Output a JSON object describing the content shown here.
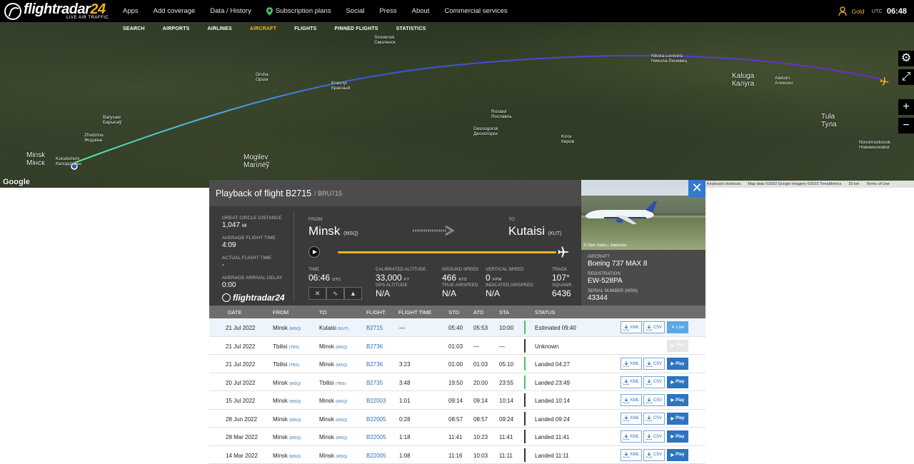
{
  "header": {
    "brand_word": "flightradar",
    "brand_num": "24",
    "brand_sub": "LIVE AIR TRAFFIC",
    "nav": [
      "Apps",
      "Add coverage",
      "Data / History",
      "Subscription plans",
      "Social",
      "Press",
      "About",
      "Commercial services"
    ],
    "user_tier": "Gold",
    "utc_label": "UTC",
    "time": "06:48"
  },
  "subnav": [
    "SEARCH",
    "AIRPORTS",
    "AIRLINES",
    "AIRCRAFT",
    "FLIGHTS",
    "PINNED FLIGHTS",
    "STATISTICS"
  ],
  "map": {
    "cities": [
      {
        "name": "Minsk\nМінск"
      },
      {
        "name": "Kolodishchi\nКалодзішчы"
      },
      {
        "name": "Zhodzina\nЖодзіна"
      },
      {
        "name": "Barysaw\nБарысаў"
      },
      {
        "name": "Mogilev\nМагілёў"
      },
      {
        "name": "Krasnyi\nКрасный"
      },
      {
        "name": "Smolensk\nСмоленск"
      },
      {
        "name": "Roslavl\nРославль"
      },
      {
        "name": "Kaluga\nКалуга"
      },
      {
        "name": "Tula\nТула"
      },
      {
        "name": "Novomoskovsk\nНовомосковск"
      },
      {
        "name": "Kirov\nКиров"
      },
      {
        "name": "Desnogorsk\nДесногорск"
      },
      {
        "name": "Nikola-Lenivets\nНикола-Ленивец"
      },
      {
        "name": "Aleksin\nАлексин"
      },
      {
        "name": "Orsha\nОрша"
      }
    ],
    "google": "Google",
    "footer": [
      "Keyboard shortcuts",
      "Map data ©2022 Google Imagery ©2022 TerraMetrics",
      "20 km",
      "Terms of Use"
    ]
  },
  "panel": {
    "title": "Playback of flight B2715",
    "subtitle": "/ BRU715",
    "stats": [
      {
        "label": "GREAT CIRCLE DISTANCE",
        "value": "1,047",
        "unit": "MI"
      },
      {
        "label": "AVERAGE FLIGHT TIME",
        "value": "4:09",
        "unit": ""
      },
      {
        "label": "ACTUAL FLIGHT TIME",
        "value": "-",
        "unit": ""
      },
      {
        "label": "AVERAGE ARRIVAL DELAY",
        "value": "0:00",
        "unit": ""
      }
    ],
    "logo": "flightradar24",
    "from_label": "FROM",
    "from_city": "Minsk",
    "from_code": "(MSQ)",
    "to_label": "TO",
    "to_city": "Kutaisi",
    "to_code": "(KUT)",
    "progress": 1.0,
    "time_label": "TIME",
    "time_value": "06:46",
    "time_unit": "UTC",
    "cal_alt_label": "CALIBRATED ALTITUDE",
    "cal_alt_value": "33,000",
    "cal_alt_unit": "FT",
    "gps_alt_label": "GPS ALTITUDE",
    "gps_alt_value": "N/A",
    "gs_label": "GROUND SPEED",
    "gs_value": "466",
    "gs_unit": "KTS",
    "tas_label": "TRUE AIRSPEED",
    "tas_value": "N/A",
    "vs_label": "VERTICAL SPEED",
    "vs_value": "0",
    "vs_unit": "FPM",
    "ias_label": "INDICATED AIRSPEED",
    "ias_value": "N/A",
    "track_label": "TRACK",
    "track_value": "107°",
    "squawk_label": "SQUAWK",
    "squawk_value": "6436"
  },
  "aircraft": {
    "photo_credit": "© Gleb Salko | Jetphotos",
    "aircraft_label": "AIRCRAFT",
    "aircraft_value": "Boeing 737 MAX 8",
    "reg_label": "REGISTRATION",
    "reg_value": "EW-528PA",
    "msn_label": "SERIAL NUMBER (MSN)",
    "msn_value": "43344"
  },
  "table": {
    "headers": [
      "DATE",
      "FROM",
      "TO",
      "FLIGHT",
      "FLIGHT TIME",
      "STD",
      "ATD",
      "STA",
      "STATUS"
    ],
    "kml": "KML",
    "csv": "CSV",
    "rows": [
      {
        "date": "21 Jul 2022",
        "from": "Minsk",
        "from_code": "(MSQ)",
        "to": "Kutaisi",
        "to_code": "(KUT)",
        "flight": "B2715",
        "ftime": "—",
        "std": "05:40",
        "atd": "05:53",
        "sta": "10:00",
        "status": "Estimated 09:40",
        "action": "Live",
        "bar": "green",
        "current": true,
        "downloads": true
      },
      {
        "date": "21 Jul 2022",
        "from": "Tbilisi",
        "from_code": "(TBS)",
        "to": "Minsk",
        "to_code": "(MSQ)",
        "flight": "B2736",
        "ftime": "",
        "std": "01:03",
        "atd": "—",
        "sta": "—",
        "status": "Unknown",
        "action": "Play",
        "bar": "dark",
        "current": false,
        "downloads": false
      },
      {
        "date": "21 Jul 2022",
        "from": "Tbilisi",
        "from_code": "(TBS)",
        "to": "Minsk",
        "to_code": "(MSQ)",
        "flight": "B2736",
        "ftime": "3:23",
        "std": "01:00",
        "atd": "01:03",
        "sta": "05:10",
        "status": "Landed 04:27",
        "action": "Play",
        "bar": "green",
        "current": false,
        "downloads": true
      },
      {
        "date": "20 Jul 2022",
        "from": "Minsk",
        "from_code": "(MSQ)",
        "to": "Tbilisi",
        "to_code": "(TBS)",
        "flight": "B2735",
        "ftime": "3:48",
        "std": "19:50",
        "atd": "20:00",
        "sta": "23:55",
        "status": "Landed 23:49",
        "action": "Play",
        "bar": "green",
        "current": false,
        "downloads": true
      },
      {
        "date": "15 Jul 2022",
        "from": "Minsk",
        "from_code": "(MSQ)",
        "to": "Minsk",
        "to_code": "(MSQ)",
        "flight": "B22003",
        "ftime": "1:01",
        "std": "09:14",
        "atd": "09:14",
        "sta": "10:14",
        "status": "Landed 10:14",
        "action": "Play",
        "bar": "dark",
        "current": false,
        "downloads": true
      },
      {
        "date": "28 Jun 2022",
        "from": "Minsk",
        "from_code": "(MSQ)",
        "to": "Minsk",
        "to_code": "(MSQ)",
        "flight": "B22005",
        "ftime": "0:28",
        "std": "08:57",
        "atd": "08:57",
        "sta": "09:24",
        "status": "Landed 09:24",
        "action": "Play",
        "bar": "dark",
        "current": false,
        "downloads": true
      },
      {
        "date": "28 Mar 2022",
        "from": "Minsk",
        "from_code": "(MSQ)",
        "to": "Minsk",
        "to_code": "(MSQ)",
        "flight": "B22005",
        "ftime": "1:18",
        "std": "11:41",
        "atd": "10:23",
        "sta": "11:41",
        "status": "Landed 11:41",
        "action": "Play",
        "bar": "dark",
        "current": false,
        "downloads": true
      },
      {
        "date": "14 Mar 2022",
        "from": "Minsk",
        "from_code": "(MSQ)",
        "to": "Minsk",
        "to_code": "(MSQ)",
        "flight": "B22005",
        "ftime": "1:08",
        "std": "11:16",
        "atd": "10:03",
        "sta": "11:11",
        "status": "Landed 11:11",
        "action": "Play",
        "bar": "dark",
        "current": false,
        "downloads": true
      }
    ]
  },
  "colors": {
    "accent": "#f5b324",
    "blue": "#2e73c0",
    "green": "#4bc069"
  }
}
